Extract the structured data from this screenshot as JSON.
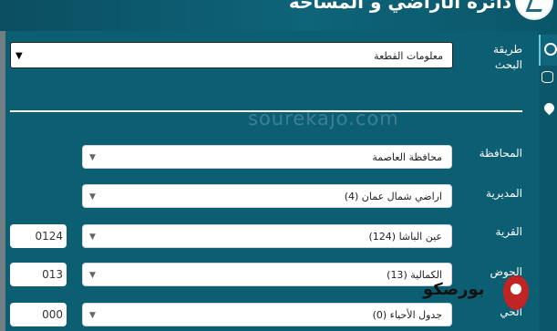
{
  "header": {
    "title": "دائرة الأراضي و المساحة"
  },
  "sidebar": {
    "icons": [
      "search-icon",
      "database-icon",
      "map-pin-icon"
    ]
  },
  "search_method": {
    "label": "طريقة البحث",
    "value": "معلومات القطعة"
  },
  "fields": [
    {
      "label": "المحافظة",
      "value": "محافظة العاصمة",
      "code": ""
    },
    {
      "label": "المديرية",
      "value": "اراضي شمال عمان (4)",
      "code": ""
    },
    {
      "label": "القرية",
      "value": "عين الباشا (124)",
      "code": "0124"
    },
    {
      "label": "الحوض",
      "value": "الكمالية (13)",
      "code": "013"
    },
    {
      "label": "الحي",
      "value": "جدول الأحياء (0)",
      "code": "000"
    }
  ],
  "watermark": "sourekajo.com",
  "brand": {
    "text": "بورصكو"
  }
}
